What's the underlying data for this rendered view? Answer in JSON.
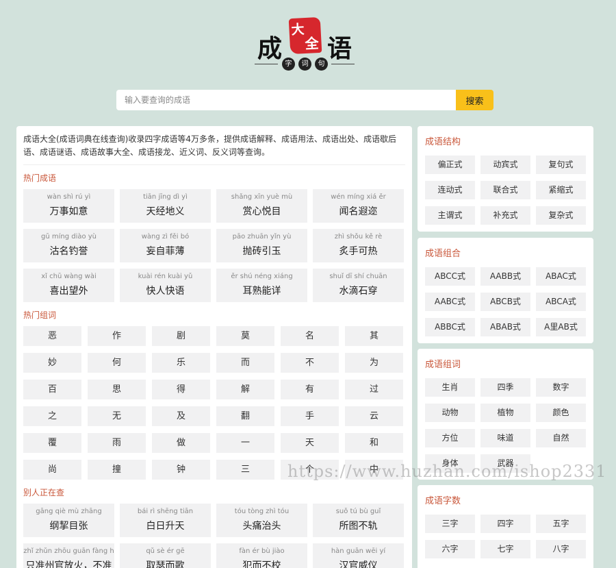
{
  "logo": {
    "left_char": "成",
    "seal_top": "大",
    "seal_bottom": "全",
    "right_char": "语",
    "sub": [
      "字",
      "词",
      "句"
    ]
  },
  "search": {
    "placeholder": "输入要查询的成语",
    "button": "搜索"
  },
  "intro": "成语大全(成语词典在线查询)收录四字成语等4万多条，提供成语解释、成语用法、成语出处、成语歇后语、成语谜语、成语故事大全、成语接龙、近义词、反义词等查询。",
  "hot_idioms": {
    "title": "热门成语",
    "items": [
      {
        "py": "wàn shì rú yì",
        "zh": "万事如意"
      },
      {
        "py": "tiān jīng dì yì",
        "zh": "天经地义"
      },
      {
        "py": "shǎng xīn yuè mù",
        "zh": "赏心悦目"
      },
      {
        "py": "wén míng xiá ěr",
        "zh": "闻名遐迩"
      },
      {
        "py": "gū míng diào yù",
        "zh": "沽名钓誉"
      },
      {
        "py": "wàng zì fěi bó",
        "zh": "妄自菲薄"
      },
      {
        "py": "pāo zhuān yǐn yù",
        "zh": "抛砖引玉"
      },
      {
        "py": "zhì shǒu kě rè",
        "zh": "炙手可热"
      },
      {
        "py": "xǐ chū wàng wài",
        "zh": "喜出望外"
      },
      {
        "py": "kuài rén kuài yǔ",
        "zh": "快人快语"
      },
      {
        "py": "ěr shú néng xiáng",
        "zh": "耳熟能详"
      },
      {
        "py": "shuǐ dī shí chuān",
        "zh": "水滴石穿"
      }
    ]
  },
  "hot_words": {
    "title": "热门组词",
    "items": [
      "恶",
      "作",
      "剧",
      "莫",
      "名",
      "其",
      "妙",
      "何",
      "乐",
      "而",
      "不",
      "为",
      "百",
      "思",
      "得",
      "解",
      "有",
      "过",
      "之",
      "无",
      "及",
      "翻",
      "手",
      "云",
      "覆",
      "雨",
      "做",
      "一",
      "天",
      "和",
      "尚",
      "撞",
      "钟",
      "三",
      "个",
      "中"
    ]
  },
  "others": {
    "title": "别人正在查",
    "items": [
      {
        "py": "gāng qiè mù zhāng",
        "zh": "纲挈目张"
      },
      {
        "py": "bái rì shēng tiān",
        "zh": "白日升天"
      },
      {
        "py": "tóu tòng zhì tóu",
        "zh": "头痛治头"
      },
      {
        "py": "suǒ tú bù guǐ",
        "zh": "所图不轨"
      },
      {
        "py": "zhǐ zhǔn zhōu guān fàng h",
        "zh": "只准州官放火，不准"
      },
      {
        "py": "qǔ sè ér gē",
        "zh": "取瑟而歌"
      },
      {
        "py": "fàn ér bù jiào",
        "zh": "犯而不校"
      },
      {
        "py": "hàn guān wēi yí",
        "zh": "汉官威仪"
      }
    ]
  },
  "structure": {
    "title": "成语结构",
    "items": [
      "偏正式",
      "动宾式",
      "复句式",
      "连动式",
      "联合式",
      "紧缩式",
      "主谓式",
      "补充式",
      "复杂式"
    ]
  },
  "combo": {
    "title": "成语组合",
    "items": [
      "ABCC式",
      "AABB式",
      "ABAC式",
      "AABC式",
      "ABCB式",
      "ABCA式",
      "ABBC式",
      "ABAB式",
      "A里AB式"
    ]
  },
  "group": {
    "title": "成语组词",
    "items": [
      "生肖",
      "四季",
      "数字",
      "动物",
      "植物",
      "颜色",
      "方位",
      "味道",
      "自然",
      "身体",
      "武器"
    ]
  },
  "count": {
    "title": "成语字数",
    "items": [
      "三字",
      "四字",
      "五字",
      "六字",
      "七字",
      "八字"
    ]
  },
  "watermark": "https://www.huzhan.com/ishop2331"
}
